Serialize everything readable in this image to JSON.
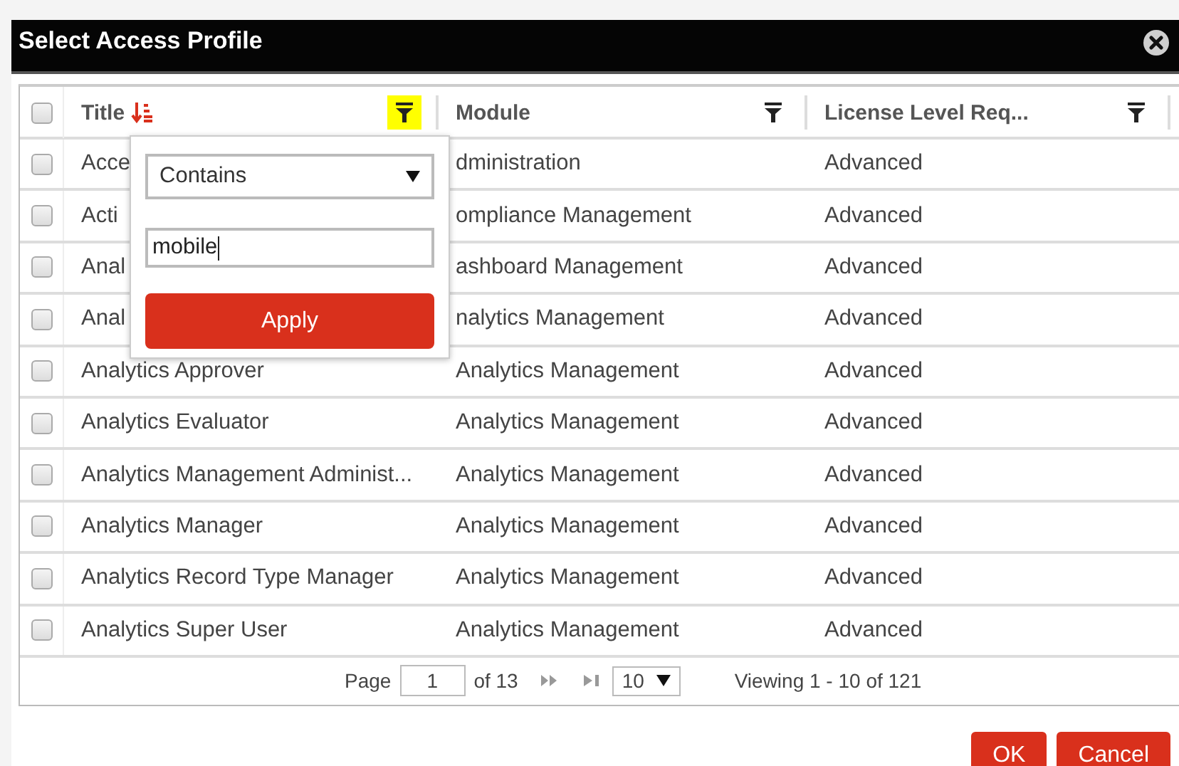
{
  "dialog": {
    "title": "Select Access Profile"
  },
  "table": {
    "select_all": {
      "checked": false
    },
    "columns": [
      {
        "label": "Title",
        "sorted": true,
        "filter_active": true
      },
      {
        "label": "Module",
        "sorted": false,
        "filter_active": false
      },
      {
        "label": "License Level Req...",
        "sorted": false,
        "filter_active": false
      }
    ],
    "rows": [
      {
        "checked": false,
        "cells": [
          "Acce",
          "dministration",
          "Advanced"
        ]
      },
      {
        "checked": false,
        "cells": [
          "Acti",
          "ompliance Management",
          "Advanced"
        ]
      },
      {
        "checked": false,
        "cells": [
          "Anal",
          "ashboard Management",
          "Advanced"
        ]
      },
      {
        "checked": false,
        "cells": [
          "Anal",
          "nalytics Management",
          "Advanced"
        ]
      },
      {
        "checked": false,
        "cells": [
          "Analytics Approver",
          "Analytics Management",
          "Advanced"
        ]
      },
      {
        "checked": false,
        "cells": [
          "Analytics Evaluator",
          "Analytics Management",
          "Advanced"
        ]
      },
      {
        "checked": false,
        "cells": [
          "Analytics Management Administ...",
          "Analytics Management",
          "Advanced"
        ]
      },
      {
        "checked": false,
        "cells": [
          "Analytics Manager",
          "Analytics Management",
          "Advanced"
        ]
      },
      {
        "checked": false,
        "cells": [
          "Analytics Record Type Manager",
          "Analytics Management",
          "Advanced"
        ]
      },
      {
        "checked": false,
        "cells": [
          "Analytics Super User",
          "Analytics Management",
          "Advanced"
        ]
      }
    ]
  },
  "filter_popup": {
    "operator": "Contains",
    "value": "mobile",
    "apply_button": "Apply"
  },
  "pager": {
    "page_label": "Page",
    "page": "1",
    "of_label": "of 13",
    "page_size": "10",
    "viewing": "Viewing 1 - 10 of 121"
  },
  "buttons": [
    "OK",
    "Cancel"
  ]
}
